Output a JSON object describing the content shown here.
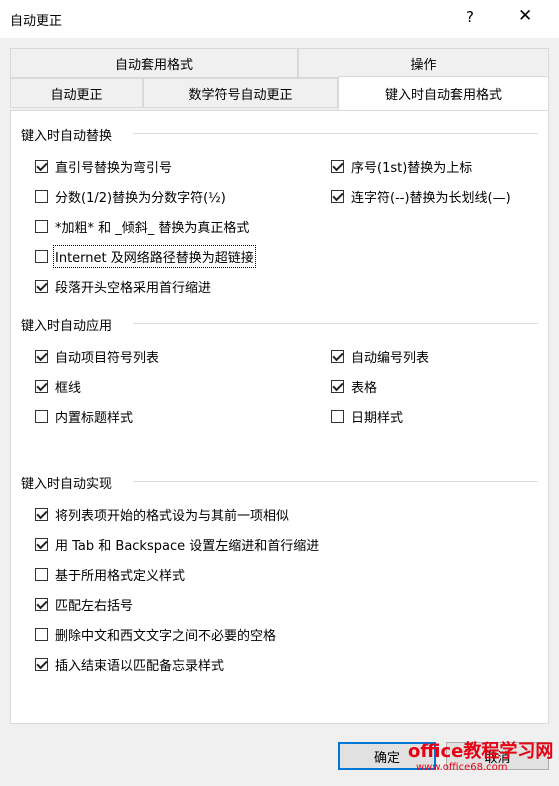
{
  "window": {
    "title": "自动更正",
    "help": "?",
    "close": "✕"
  },
  "tabs_top": [
    "自动套用格式",
    "操作"
  ],
  "tabs_bottom": [
    "自动更正",
    "数学符号自动更正",
    "键入时自动套用格式"
  ],
  "sections": [
    {
      "title": "键入时自动替换"
    },
    {
      "title": "键入时自动应用"
    },
    {
      "title": "键入时自动实现"
    }
  ],
  "options": {
    "smart_quotes": {
      "label": "直引号替换为弯引号",
      "checked": true
    },
    "fractions": {
      "label": "分数(1/2)替换为分数字符(½)",
      "checked": false
    },
    "bold_italic": {
      "label": "*加粗* 和 _倾斜_ 替换为真正格式",
      "checked": false
    },
    "hyperlinks": {
      "label": "Internet 及网络路径替换为超链接",
      "checked": false
    },
    "first_indent": {
      "label": "段落开头空格采用首行缩进",
      "checked": true
    },
    "ordinals": {
      "label": "序号(1st)替换为上标",
      "checked": true
    },
    "dashes": {
      "label": "连字符(--)替换为长划线(—)",
      "checked": true
    },
    "bullets": {
      "label": "自动项目符号列表",
      "checked": true
    },
    "borders": {
      "label": "框线",
      "checked": true
    },
    "builtin_headings": {
      "label": "内置标题样式",
      "checked": false
    },
    "numbered": {
      "label": "自动编号列表",
      "checked": true
    },
    "tables": {
      "label": "表格",
      "checked": true
    },
    "date_styles": {
      "label": "日期样式",
      "checked": false
    },
    "list_format": {
      "label": "将列表项开始的格式设为与其前一项相似",
      "checked": true
    },
    "tab_backspace": {
      "label": "用 Tab 和 Backspace 设置左缩进和首行缩进",
      "checked": true
    },
    "define_styles": {
      "label": "基于所用格式定义样式",
      "checked": false
    },
    "match_parens": {
      "label": "匹配左右括号",
      "checked": true
    },
    "remove_spaces": {
      "label": "删除中文和西文文字之间不必要的空格",
      "checked": false
    },
    "closing_phrase": {
      "label": "插入结束语以匹配备忘录样式",
      "checked": true
    }
  },
  "buttons": {
    "ok": "确定",
    "cancel": "取消"
  },
  "watermark": {
    "text": "office教程学习网",
    "url": "www.office68.com"
  }
}
